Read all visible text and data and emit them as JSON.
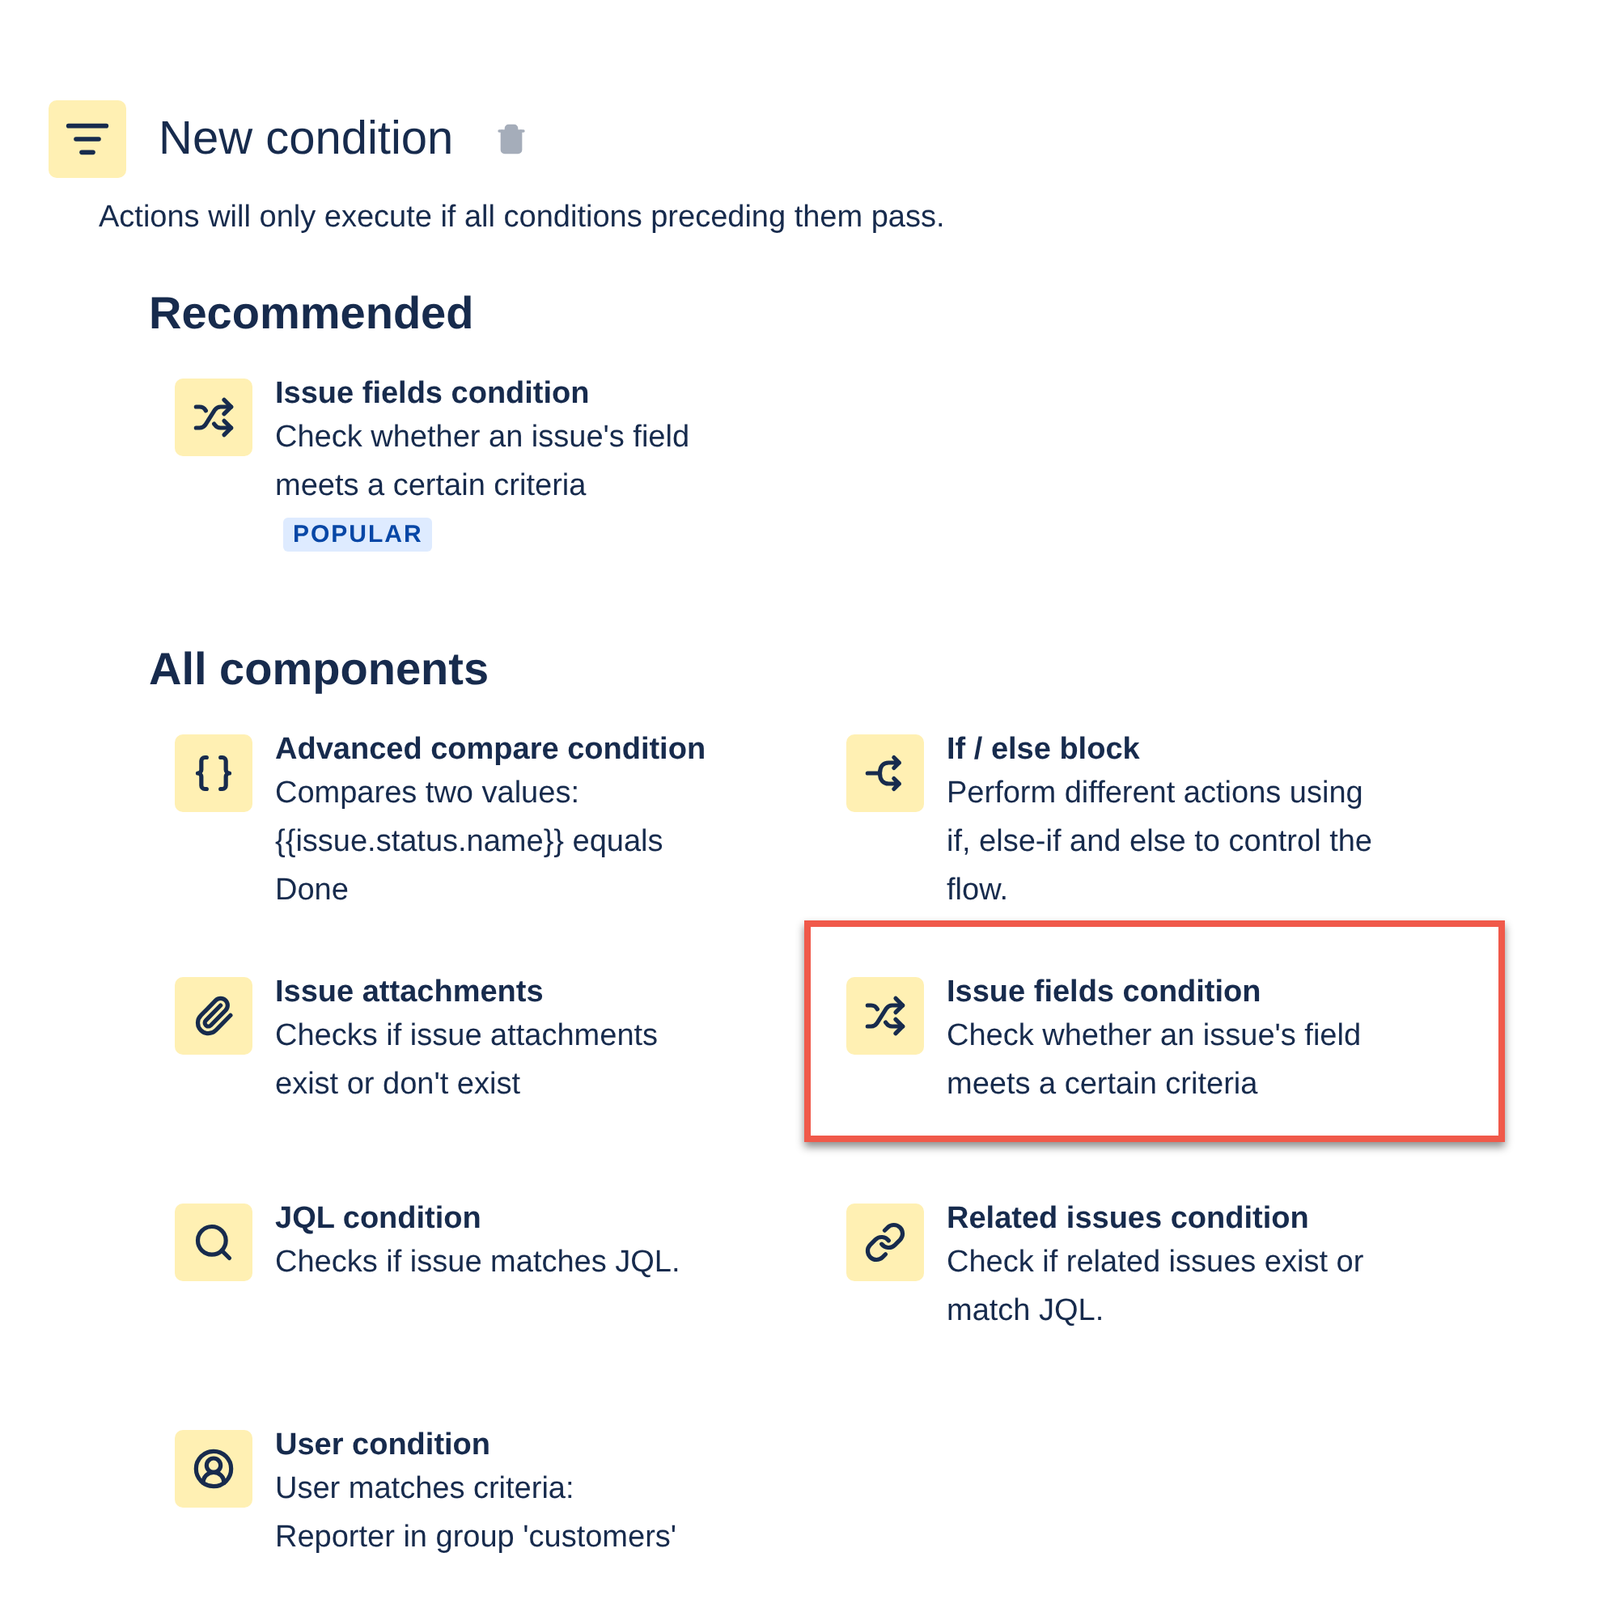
{
  "header": {
    "title": "New condition",
    "subtitle": "Actions will only execute if all conditions preceding them pass."
  },
  "sections": [
    {
      "heading": "Recommended",
      "items": [
        {
          "kind": "shuffle",
          "title": "Issue fields condition",
          "lines": [
            "Check whether an issue's field",
            "meets a certain criteria"
          ],
          "badge": "POPULAR",
          "highlighted": false
        }
      ]
    },
    {
      "heading": "All components",
      "items": [
        {
          "kind": "braces",
          "title": "Advanced compare condition",
          "lines": [
            "Compares two values:",
            "{{issue.status.name}} equals",
            "Done"
          ],
          "highlighted": false
        },
        {
          "kind": "branch",
          "title": "If / else block",
          "lines": [
            "Perform different actions using",
            "if, else-if and else to control the",
            "flow."
          ],
          "highlighted": false
        },
        {
          "kind": "paperclip",
          "title": "Issue attachments",
          "lines": [
            "Checks if issue attachments",
            "exist or don't exist"
          ],
          "highlighted": false
        },
        {
          "kind": "shuffle",
          "title": "Issue fields condition",
          "lines": [
            "Check whether an issue's field",
            "meets a certain criteria"
          ],
          "highlighted": true
        },
        {
          "kind": "search",
          "title": "JQL condition",
          "lines": [
            "Checks if issue matches JQL."
          ],
          "highlighted": false
        },
        {
          "kind": "link",
          "title": "Related issues condition",
          "lines": [
            "Check if related issues exist or",
            "match JQL."
          ],
          "highlighted": false
        },
        {
          "kind": "user",
          "title": "User condition",
          "lines": [
            "User matches criteria:",
            "Reporter in group 'customers'"
          ],
          "highlighted": false
        }
      ]
    }
  ]
}
